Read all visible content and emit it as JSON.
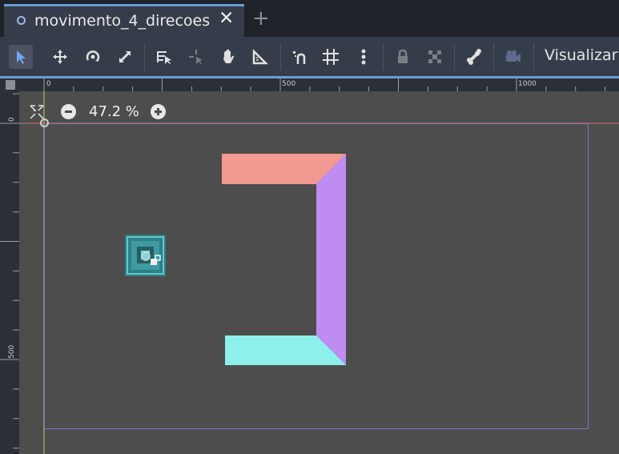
{
  "tab": {
    "title": "movimento_4_direcoes",
    "close_glyph": "✕",
    "add_glyph": "+"
  },
  "toolbar": {
    "tools": [
      {
        "name": "select-tool",
        "icon": "arrow-cursor-icon",
        "active": true
      },
      {
        "name": "move-tool",
        "icon": "move-arrows-icon"
      },
      {
        "name": "rotate-tool",
        "icon": "rotate-icon"
      },
      {
        "name": "scale-tool",
        "icon": "scale-icon"
      },
      {
        "name": "list-select-tool",
        "icon": "list-select-icon"
      },
      {
        "name": "pivot-tool",
        "icon": "pivot-icon",
        "disabled": true
      },
      {
        "name": "pan-tool",
        "icon": "hand-icon"
      },
      {
        "name": "ruler-tool",
        "icon": "ruler-icon"
      },
      {
        "name": "smart-snap-toggle",
        "icon": "magnet-snap-icon"
      },
      {
        "name": "grid-snap-toggle",
        "icon": "grid-icon"
      },
      {
        "name": "snap-options",
        "icon": "kebab-menu-icon"
      },
      {
        "name": "lock-button",
        "icon": "lock-icon",
        "disabled": true
      },
      {
        "name": "group-button",
        "icon": "group-icon",
        "disabled": true
      },
      {
        "name": "skeleton-button",
        "icon": "bone-icon"
      },
      {
        "name": "camera-button",
        "icon": "camera-icon",
        "disabled": true
      }
    ],
    "view_label": "Visualizar"
  },
  "rulers": {
    "horizontal_labels": [
      "0",
      "500",
      "1000"
    ],
    "vertical_labels": [
      "0",
      "500"
    ]
  },
  "viewport": {
    "zoom_level": "47.2 %",
    "colors": {
      "background": "#4d4d4d",
      "top_bar": "#f29a90",
      "side_bar": "#bf8cf2",
      "bottom_bar": "#8df0ea",
      "x_axis": "#d36c6c",
      "y_axis": "#b9d46b",
      "screen_rect": "#8a74c9"
    }
  }
}
